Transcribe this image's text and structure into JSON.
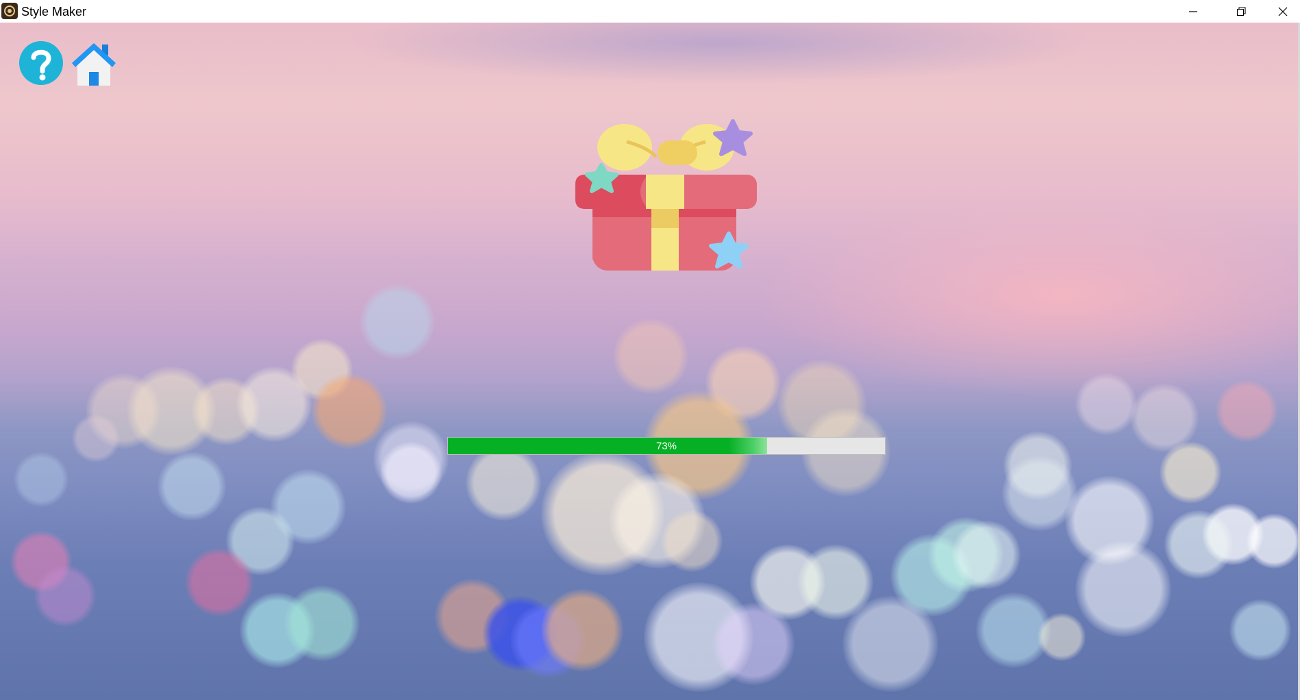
{
  "window": {
    "title": "Style Maker",
    "icon": "app-icon",
    "controls": [
      "minimize-icon",
      "restore-icon",
      "close-icon"
    ]
  },
  "toolbar": {
    "help_icon": "question-icon",
    "home_icon": "home-icon"
  },
  "hero": {
    "icon": "gift-box-icon"
  },
  "progress": {
    "value": 0.73,
    "label": "73%"
  },
  "colors": {
    "progress_fill": "#06b025",
    "progress_track": "#e6e6e6",
    "help_icon": "#1eb4d8",
    "home_roof": "#2196f3"
  }
}
